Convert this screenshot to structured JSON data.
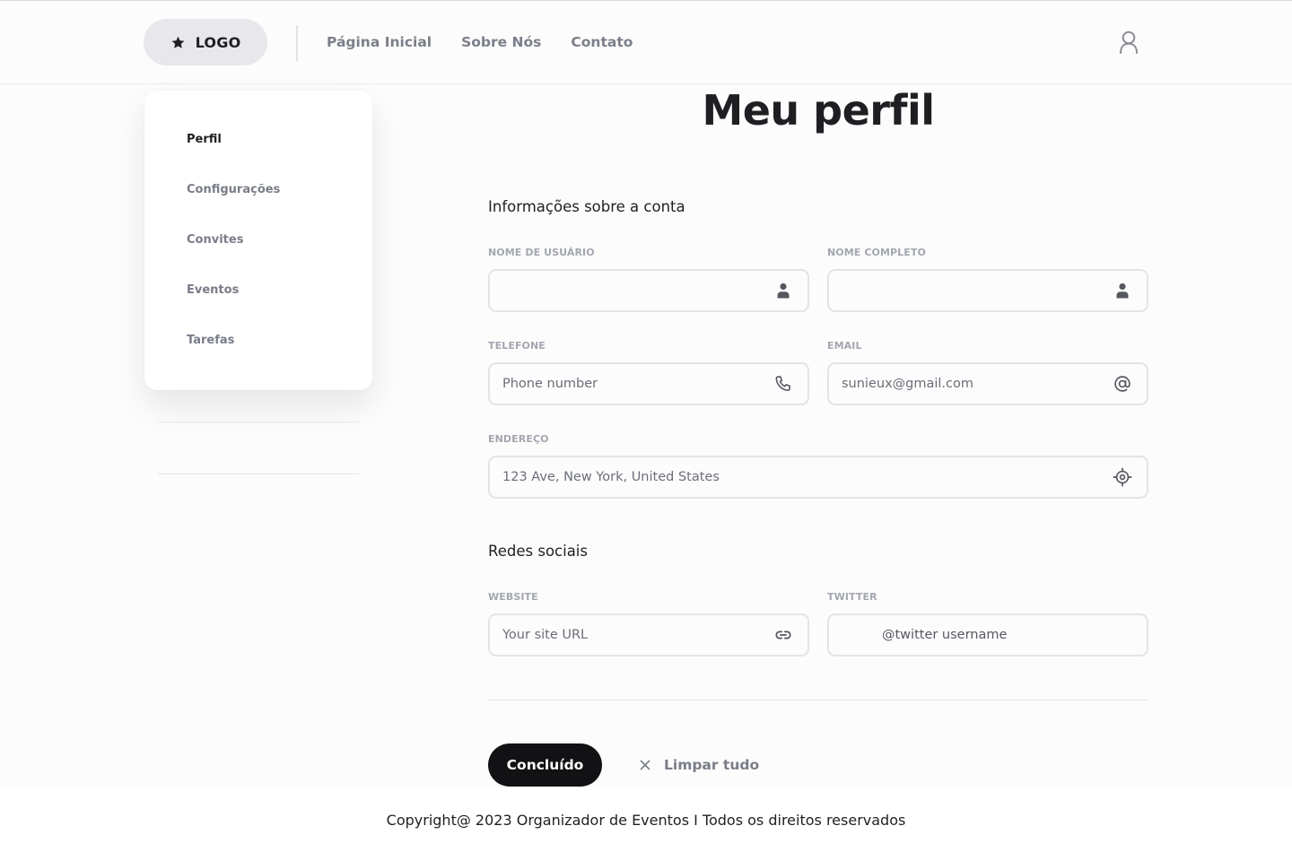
{
  "header": {
    "logo_label": "LOGO",
    "nav": [
      "Página Inicial",
      "Sobre Nós",
      "Contato"
    ]
  },
  "sidebar": {
    "items": [
      {
        "label": "Perfil",
        "active": true
      },
      {
        "label": "Configurações",
        "active": false
      },
      {
        "label": "Convites",
        "active": false
      },
      {
        "label": "Eventos",
        "active": false
      },
      {
        "label": "Tarefas",
        "active": false
      }
    ]
  },
  "main": {
    "title": "Meu perfil",
    "account_section": {
      "heading": "Informações sobre a conta",
      "username": {
        "label": "NOME DE USUÁRIO",
        "value": "",
        "icon": "user-icon"
      },
      "fullname": {
        "label": "NOME COMPLETO",
        "value": "",
        "icon": "user-icon"
      },
      "phone": {
        "label": "TELEFONE",
        "placeholder": "Phone number",
        "icon": "phone-icon"
      },
      "email": {
        "label": "EMAIL",
        "value": "sunieux@gmail.com",
        "icon": "at-sign-icon"
      },
      "address": {
        "label": "ENDEREÇO",
        "value": "123 Ave, New York, United States",
        "icon": "location-target-icon"
      }
    },
    "social_section": {
      "heading": "Redes sociais",
      "website": {
        "label": "WEBSITE",
        "placeholder": "Your site URL",
        "icon": "link-icon"
      },
      "twitter": {
        "label": "TWITTER",
        "placeholder": "@twitter username"
      }
    },
    "actions": {
      "done_label": "Concluído",
      "clear_label": "Limpar tudo"
    }
  },
  "footer": {
    "copyright": "Copyright@ 2023 Organizador de Eventos I Todos os direitos reservados"
  },
  "colors": {
    "background": "#fcfcfc",
    "primary_button": "#121214",
    "muted_text": "#7a7d88",
    "border": "#e3e3e8"
  }
}
